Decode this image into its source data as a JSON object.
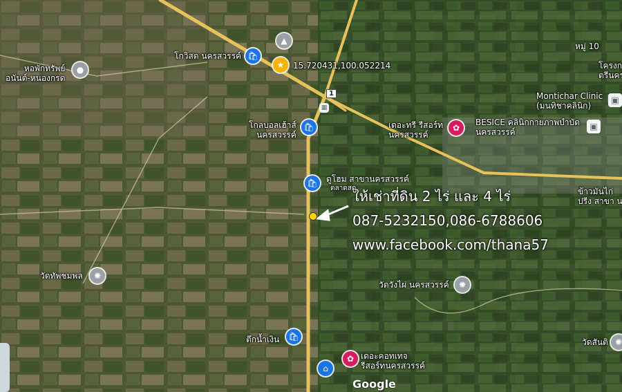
{
  "overlay": {
    "title": "ให้เช่าที่ดิน 2 ไร่ และ 4 ไร่",
    "phones": "087-5232150,086-6788606",
    "facebook": "www.facebook.com/thana57"
  },
  "coordinates_label": "15.720431,100.052214",
  "places": [
    {
      "label": "หอพักทรัพย์\nอนันต์-หนองกรด",
      "icon": "place-icon",
      "style": "gray"
    },
    {
      "label": "โกวิสด นครสวรรค์",
      "icon": "shopping-bag-icon",
      "style": "blue"
    },
    {
      "label": "โกลบอลเฮ้าส์\nนครสวรรค์",
      "icon": "shopping-bag-icon",
      "style": "blue"
    },
    {
      "label": "ดูโฮม สาขานครสวรรค์",
      "icon": "shopping-bag-icon",
      "style": "blue"
    },
    {
      "label": "ตลาดสด",
      "icon": "",
      "style": "text"
    },
    {
      "label": "เดอะทรี รีสอร์ท\nนครสวรรค์",
      "icon": "hotel-icon",
      "style": "pink"
    },
    {
      "label": "BESICE คลินิกกายภาพบำบัด\nนครสวรรค์",
      "icon": "clinic-icon",
      "style": "square"
    },
    {
      "label": "Montichar Clinic\n(มนทิชาคลินิก)",
      "icon": "clinic-icon",
      "style": "square"
    },
    {
      "label": "หมู่ 10",
      "icon": "",
      "style": "text"
    },
    {
      "label": "โครงก\nตรีนคร",
      "icon": "",
      "style": "text"
    },
    {
      "label": "ข้าวมันไก่\nปรีง สาขา นค",
      "icon": "",
      "style": "text"
    },
    {
      "label": "วัดทัพชมพล",
      "icon": "temple-icon",
      "style": "gray"
    },
    {
      "label": "วัดวังไผ่ นครสวรรค์",
      "icon": "temple-icon",
      "style": "gray"
    },
    {
      "label": "วัดสันติ",
      "icon": "temple-icon",
      "style": "gray"
    },
    {
      "label": "ตึกน้ำเงิน",
      "icon": "shopping-bag-icon",
      "style": "blue"
    },
    {
      "label": "เดอะคอทเทจ\nรีสอร์ทนครสวรรค์",
      "icon": "hotel-icon",
      "style": "pink"
    }
  ],
  "road_badge": "1",
  "attribution": "Google",
  "colors": {
    "road": "#e7c25a",
    "marker": "#ffd600",
    "blue_pin": "#1a73e8",
    "pink_pin": "#d81b60"
  }
}
